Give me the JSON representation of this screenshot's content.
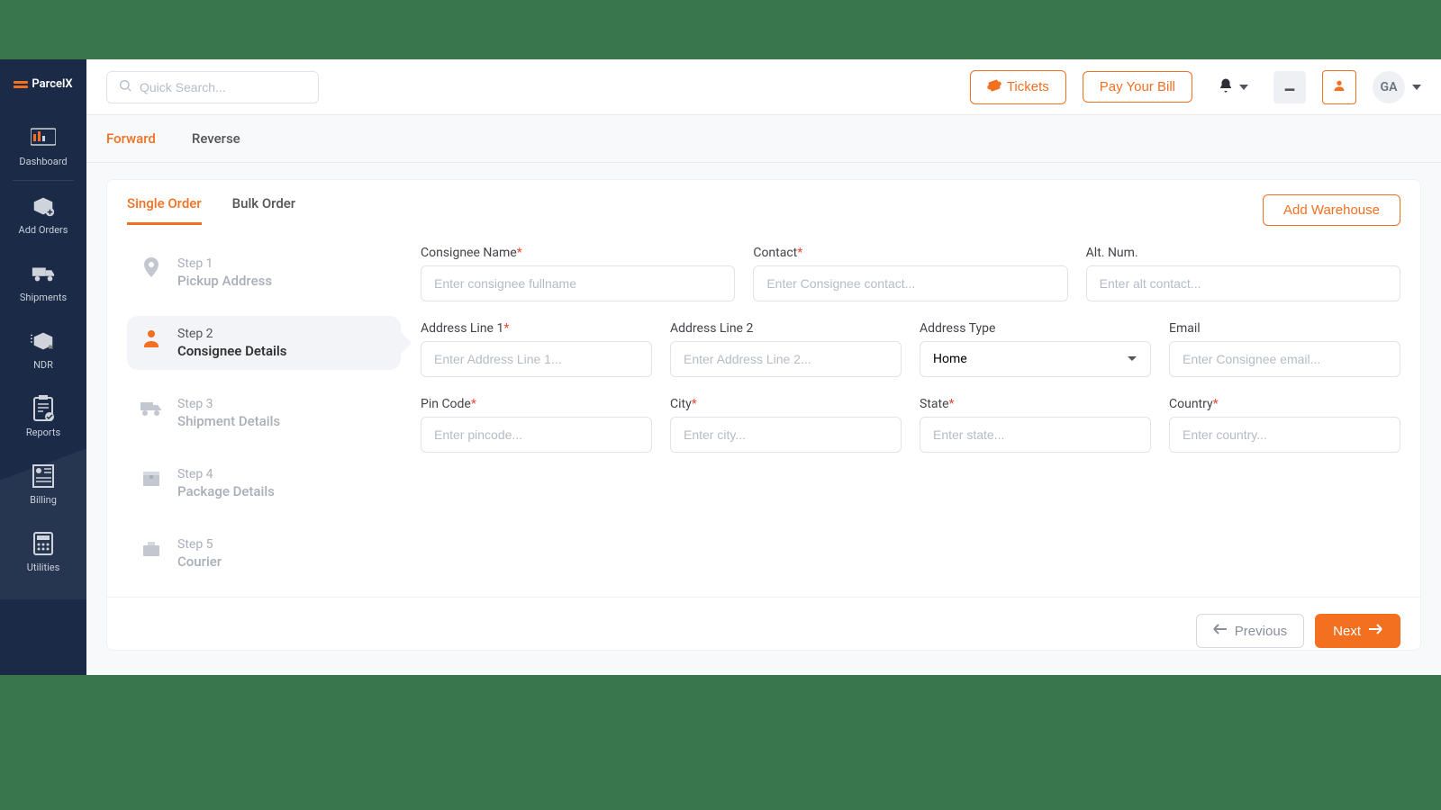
{
  "brand": "ParcelX",
  "header": {
    "search_placeholder": "Quick Search...",
    "tickets": "Tickets",
    "pay_bill": "Pay Your Bill",
    "avatar": "GA"
  },
  "sidebar": {
    "items": [
      {
        "label": "Dashboard"
      },
      {
        "label": "Add Orders"
      },
      {
        "label": "Shipments"
      },
      {
        "label": "NDR"
      },
      {
        "label": "Reports"
      },
      {
        "label": "Billing"
      },
      {
        "label": "Utilities"
      }
    ]
  },
  "page_tabs": {
    "forward": "Forward",
    "reverse": "Reverse"
  },
  "card_tabs": {
    "single": "Single Order",
    "bulk": "Bulk Order"
  },
  "add_warehouse": "Add Warehouse",
  "steps": [
    {
      "label": "Step 1",
      "title": "Pickup Address"
    },
    {
      "label": "Step 2",
      "title": "Consignee Details"
    },
    {
      "label": "Step 3",
      "title": "Shipment Details"
    },
    {
      "label": "Step 4",
      "title": "Package Details"
    },
    {
      "label": "Step 5",
      "title": "Courier"
    }
  ],
  "fields": {
    "consignee_name": {
      "label": "Consignee Name",
      "placeholder": "Enter consignee fullname",
      "required": true
    },
    "contact": {
      "label": "Contact",
      "placeholder": "Enter Consignee contact...",
      "required": true
    },
    "alt_num": {
      "label": "Alt. Num.",
      "placeholder": "Enter alt contact...",
      "required": false
    },
    "addr1": {
      "label": "Address Line 1",
      "placeholder": "Enter Address Line 1...",
      "required": true
    },
    "addr2": {
      "label": "Address Line 2",
      "placeholder": "Enter Address Line 2...",
      "required": false
    },
    "addr_type": {
      "label": "Address Type",
      "value": "Home",
      "required": false
    },
    "email": {
      "label": "Email",
      "placeholder": "Enter Consignee email...",
      "required": false
    },
    "pincode": {
      "label": "Pin Code",
      "placeholder": "Enter pincode...",
      "required": true
    },
    "city": {
      "label": "City",
      "placeholder": "Enter city...",
      "required": true
    },
    "state": {
      "label": "State",
      "placeholder": "Enter state...",
      "required": true
    },
    "country": {
      "label": "Country",
      "placeholder": "Enter country...",
      "required": true
    }
  },
  "footer": {
    "prev": "Previous",
    "next": "Next"
  }
}
